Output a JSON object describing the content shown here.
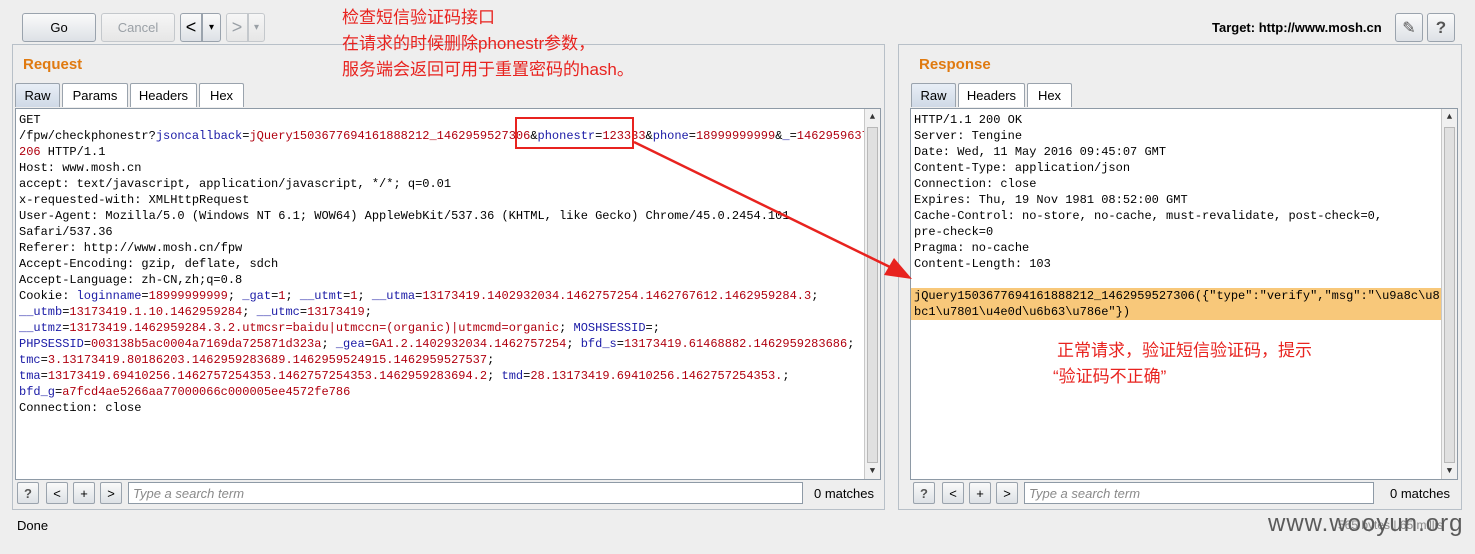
{
  "toolbar": {
    "go_label": "Go",
    "cancel_label": "Cancel",
    "back_label": "<",
    "back_menu_label": "▾",
    "forward_label": ">",
    "forward_menu_label": "▾",
    "target_label": "Target: http://www.mosh.cn",
    "edit_label": "✎",
    "help_label": "?"
  },
  "annotation_top": [
    "检查短信验证码接口",
    "在请求的时候删除phonestr参数，",
    "服务端会返回可用于重置密码的hash。"
  ],
  "annotation_right": [
    "正常请求，验证短信验证码，提示",
    "“验证码不正确”"
  ],
  "request": {
    "title": "Request",
    "tabs": [
      "Raw",
      "Params",
      "Headers",
      "Hex"
    ],
    "lines": [
      [
        {
          "t": "GET",
          "c": ""
        }
      ],
      [
        {
          "t": "/fpw/checkphonestr?",
          "c": ""
        },
        {
          "t": "jsoncallback",
          "c": "k"
        },
        {
          "t": "=",
          "c": ""
        },
        {
          "t": "jQuery1503677694161888212_1462959527306",
          "c": "v"
        },
        {
          "t": "&",
          "c": ""
        },
        {
          "t": "phonestr",
          "c": "k"
        },
        {
          "t": "=",
          "c": ""
        },
        {
          "t": "123333",
          "c": "v"
        },
        {
          "t": "&",
          "c": ""
        },
        {
          "t": "phone",
          "c": "k"
        },
        {
          "t": "=",
          "c": ""
        },
        {
          "t": "18999999999",
          "c": "v"
        },
        {
          "t": "&",
          "c": ""
        },
        {
          "t": "_",
          "c": "k"
        },
        {
          "t": "=",
          "c": ""
        },
        {
          "t": "1462959637",
          "c": "v"
        }
      ],
      [
        {
          "t": "206",
          "c": "v"
        },
        {
          "t": " HTTP/1.1",
          "c": ""
        }
      ],
      [
        {
          "t": "Host: www.mosh.cn",
          "c": ""
        }
      ],
      [
        {
          "t": "accept: text/javascript, application/javascript, */*; q=0.01",
          "c": ""
        }
      ],
      [
        {
          "t": "x-requested-with: XMLHttpRequest",
          "c": ""
        }
      ],
      [
        {
          "t": "User-Agent: Mozilla/5.0 (Windows NT 6.1; WOW64) AppleWebKit/537.36 (KHTML, like Gecko) Chrome/45.0.2454.101",
          "c": ""
        }
      ],
      [
        {
          "t": "Safari/537.36",
          "c": ""
        }
      ],
      [
        {
          "t": "Referer: http://www.mosh.cn/fpw",
          "c": ""
        }
      ],
      [
        {
          "t": "Accept-Encoding: gzip, deflate, sdch",
          "c": ""
        }
      ],
      [
        {
          "t": "Accept-Language: zh-CN,zh;q=0.8",
          "c": ""
        }
      ],
      [
        {
          "t": "Cookie: ",
          "c": ""
        },
        {
          "t": "loginname",
          "c": "k"
        },
        {
          "t": "=",
          "c": ""
        },
        {
          "t": "18999999999",
          "c": "v"
        },
        {
          "t": "; ",
          "c": ""
        },
        {
          "t": "_gat",
          "c": "k"
        },
        {
          "t": "=",
          "c": ""
        },
        {
          "t": "1",
          "c": "v"
        },
        {
          "t": "; ",
          "c": ""
        },
        {
          "t": "__utmt",
          "c": "k"
        },
        {
          "t": "=",
          "c": ""
        },
        {
          "t": "1",
          "c": "v"
        },
        {
          "t": "; ",
          "c": ""
        },
        {
          "t": "__utma",
          "c": "k"
        },
        {
          "t": "=",
          "c": ""
        },
        {
          "t": "13173419.1402932034.1462757254.1462767612.1462959284.3",
          "c": "v"
        },
        {
          "t": ";",
          "c": ""
        }
      ],
      [
        {
          "t": "__utmb",
          "c": "k"
        },
        {
          "t": "=",
          "c": ""
        },
        {
          "t": "13173419.1.10.1462959284",
          "c": "v"
        },
        {
          "t": "; ",
          "c": ""
        },
        {
          "t": "__utmc",
          "c": "k"
        },
        {
          "t": "=",
          "c": ""
        },
        {
          "t": "13173419",
          "c": "v"
        },
        {
          "t": ";",
          "c": ""
        }
      ],
      [
        {
          "t": "__utmz",
          "c": "k"
        },
        {
          "t": "=",
          "c": ""
        },
        {
          "t": "13173419.1462959284.3.2.utmcsr=baidu|utmccn=(organic)|utmcmd=organic",
          "c": "v"
        },
        {
          "t": "; ",
          "c": ""
        },
        {
          "t": "MOSHSESSID",
          "c": "k"
        },
        {
          "t": "=;",
          "c": ""
        }
      ],
      [
        {
          "t": "PHPSESSID",
          "c": "k"
        },
        {
          "t": "=",
          "c": ""
        },
        {
          "t": "003138b5ac0004a7169da725871d323a",
          "c": "v"
        },
        {
          "t": "; ",
          "c": ""
        },
        {
          "t": "_gea",
          "c": "k"
        },
        {
          "t": "=",
          "c": ""
        },
        {
          "t": "GA1.2.1402932034.1462757254",
          "c": "v"
        },
        {
          "t": "; ",
          "c": ""
        },
        {
          "t": "bfd_s",
          "c": "k"
        },
        {
          "t": "=",
          "c": ""
        },
        {
          "t": "13173419.61468882.1462959283686",
          "c": "v"
        },
        {
          "t": ";",
          "c": ""
        }
      ],
      [
        {
          "t": "tmc",
          "c": "k"
        },
        {
          "t": "=",
          "c": ""
        },
        {
          "t": "3.13173419.80186203.1462959283689.1462959524915.1462959527537",
          "c": "v"
        },
        {
          "t": ";",
          "c": ""
        }
      ],
      [
        {
          "t": "tma",
          "c": "k"
        },
        {
          "t": "=",
          "c": ""
        },
        {
          "t": "13173419.69410256.1462757254353.1462757254353.1462959283694.2",
          "c": "v"
        },
        {
          "t": "; ",
          "c": ""
        },
        {
          "t": "tmd",
          "c": "k"
        },
        {
          "t": "=",
          "c": ""
        },
        {
          "t": "28.13173419.69410256.1462757254353.",
          "c": "v"
        },
        {
          "t": ";",
          "c": ""
        }
      ],
      [
        {
          "t": "bfd_g",
          "c": "k"
        },
        {
          "t": "=",
          "c": ""
        },
        {
          "t": "a7fcd4ae5266aa77000066c000005ee4572fe786",
          "c": "v"
        }
      ],
      [
        {
          "t": "Connection: close",
          "c": ""
        }
      ]
    ],
    "search_placeholder": "Type a search term",
    "matches": "0 matches"
  },
  "response": {
    "title": "Response",
    "tabs": [
      "Raw",
      "Headers",
      "Hex"
    ],
    "lines": [
      {
        "t": "HTTP/1.1 200 OK",
        "hl": false
      },
      {
        "t": "Server: Tengine",
        "hl": false
      },
      {
        "t": "Date: Wed, 11 May 2016 09:45:07 GMT",
        "hl": false
      },
      {
        "t": "Content-Type: application/json",
        "hl": false
      },
      {
        "t": "Connection: close",
        "hl": false
      },
      {
        "t": "Expires: Thu, 19 Nov 1981 08:52:00 GMT",
        "hl": false
      },
      {
        "t": "Cache-Control: no-store, no-cache, must-revalidate, post-check=0,",
        "hl": false
      },
      {
        "t": "pre-check=0",
        "hl": false
      },
      {
        "t": "Pragma: no-cache",
        "hl": false
      },
      {
        "t": "Content-Length: 103",
        "hl": false
      },
      {
        "t": "",
        "hl": false
      },
      {
        "t": "jQuery1503677694161888212_1462959527306({\"type\":\"verify\",\"msg\":\"\\u9a8c\\u8",
        "hl": true
      },
      {
        "t": "bc1\\u7801\\u4e0d\\u6b63\\u786e\"})",
        "hl": true
      }
    ],
    "search_placeholder": "Type a search term",
    "matches": "0 matches"
  },
  "status": {
    "text": "Done",
    "bytes": "565 bytes | 65 millis"
  },
  "watermark": "www.wooyun.org",
  "colors": {
    "accent_title": "#e07a10",
    "annotation": "#e8231f",
    "param_name": "#1a1aa6",
    "param_value": "#b0000f",
    "highlight": "#f8c87a"
  }
}
